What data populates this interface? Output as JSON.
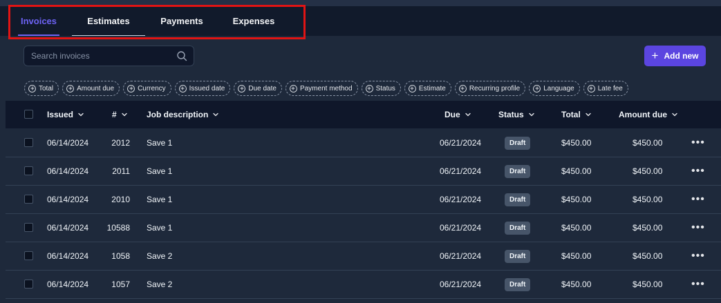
{
  "tabs": [
    {
      "label": "Invoices",
      "active": true
    },
    {
      "label": "Estimates",
      "active": false
    },
    {
      "label": "Payments",
      "active": false
    },
    {
      "label": "Expenses",
      "active": false
    }
  ],
  "search": {
    "placeholder": "Search invoices",
    "value": ""
  },
  "add_button": {
    "label": "Add new"
  },
  "filters": [
    "Total",
    "Amount due",
    "Currency",
    "Issued date",
    "Due date",
    "Payment method",
    "Status",
    "Estimate",
    "Recurring profile",
    "Language",
    "Late fee"
  ],
  "columns": {
    "issued": "Issued",
    "number": "#",
    "job": "Job description",
    "due": "Due",
    "status": "Status",
    "total": "Total",
    "amount_due": "Amount due"
  },
  "rows": [
    {
      "issued": "06/14/2024",
      "number": "2012",
      "job": "Save 1",
      "due": "06/21/2024",
      "status": "Draft",
      "total": "$450.00",
      "amount_due": "$450.00"
    },
    {
      "issued": "06/14/2024",
      "number": "2011",
      "job": "Save 1",
      "due": "06/21/2024",
      "status": "Draft",
      "total": "$450.00",
      "amount_due": "$450.00"
    },
    {
      "issued": "06/14/2024",
      "number": "2010",
      "job": "Save 1",
      "due": "06/21/2024",
      "status": "Draft",
      "total": "$450.00",
      "amount_due": "$450.00"
    },
    {
      "issued": "06/14/2024",
      "number": "10588",
      "job": "Save 1",
      "due": "06/21/2024",
      "status": "Draft",
      "total": "$450.00",
      "amount_due": "$450.00"
    },
    {
      "issued": "06/14/2024",
      "number": "1058",
      "job": "Save 2",
      "due": "06/21/2024",
      "status": "Draft",
      "total": "$450.00",
      "amount_due": "$450.00"
    },
    {
      "issued": "06/14/2024",
      "number": "1057",
      "job": "Save 2",
      "due": "06/21/2024",
      "status": "Draft",
      "total": "$450.00",
      "amount_due": "$450.00"
    }
  ],
  "colors": {
    "accent": "#6d63f5",
    "button": "#5b45e0",
    "highlight": "#e11414"
  }
}
